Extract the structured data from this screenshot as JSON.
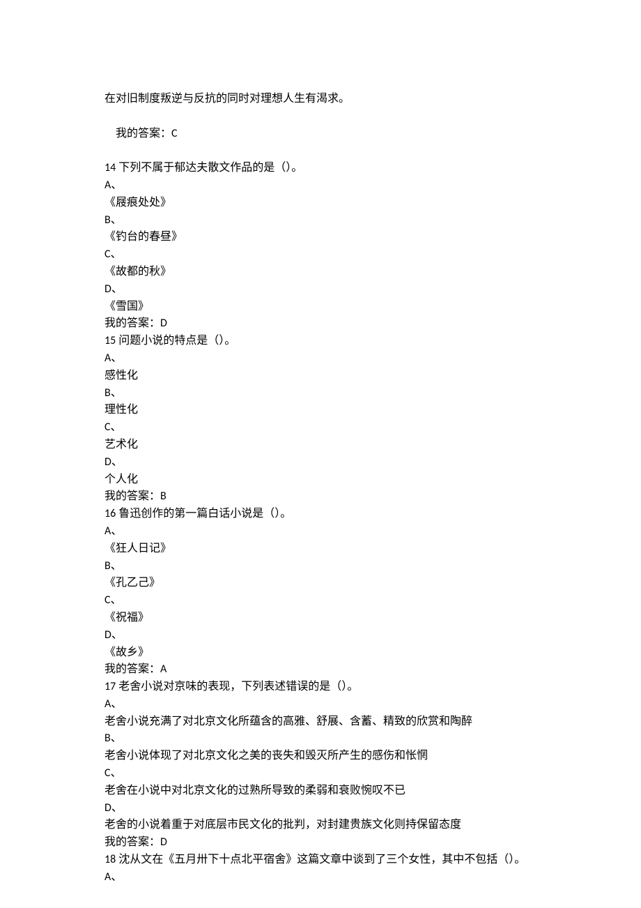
{
  "intro_line": "在对旧制度叛逆与反抗的同时对理想人生有渴求。",
  "intro_answer_prefix": "我的答案：",
  "intro_answer": "C",
  "questions": [
    {
      "num": "14",
      "stem": " 下列不属于郁达夫散文作品的是（）。",
      "opts": [
        {
          "k": "A",
          "v": "《屐痕处处》"
        },
        {
          "k": "B",
          "v": "《钓台的春昼》"
        },
        {
          "k": "C",
          "v": "《故都的秋》"
        },
        {
          "k": "D",
          "v": "《雪国》"
        }
      ],
      "ans": "D"
    },
    {
      "num": "15",
      "stem": " 问题小说的特点是（）。",
      "opts": [
        {
          "k": "A",
          "v": "感性化"
        },
        {
          "k": "B",
          "v": "理性化"
        },
        {
          "k": "C",
          "v": "艺术化"
        },
        {
          "k": "D",
          "v": "个人化"
        }
      ],
      "ans": "B"
    },
    {
      "num": "16",
      "stem": " 鲁迅创作的第一篇白话小说是（）。",
      "opts": [
        {
          "k": "A",
          "v": "《狂人日记》"
        },
        {
          "k": "B",
          "v": "《孔乙己》"
        },
        {
          "k": "C",
          "v": "《祝福》"
        },
        {
          "k": "D",
          "v": "《故乡》"
        }
      ],
      "ans": "A"
    },
    {
      "num": "17",
      "stem": " 老舍小说对京味的表现，下列表述错误的是（）。",
      "opts": [
        {
          "k": "A",
          "v": "老舍小说充满了对北京文化所蕴含的高雅、舒展、含蓄、精致的欣赏和陶醉"
        },
        {
          "k": "B",
          "v": "老舍小说体现了对北京文化之美的丧失和毁灭所产生的感伤和怅惘"
        },
        {
          "k": "C",
          "v": "老舍在小说中对北京文化的过熟所导致的柔弱和衰败惋叹不已"
        },
        {
          "k": "D",
          "v": "老舍的小说着重于对底层市民文化的批判，对封建贵族文化则持保留态度"
        }
      ],
      "ans": "D"
    },
    {
      "num": "18",
      "stem": " 沈从文在《五月卅下十点北平宿舍》这篇文章中谈到了三个女性，其中不包括（）。",
      "opts": [
        {
          "k": "A",
          "v": ""
        }
      ],
      "truncated": true
    }
  ],
  "labels": {
    "answer_prefix": "我的答案：",
    "opt_suffix": "、"
  }
}
